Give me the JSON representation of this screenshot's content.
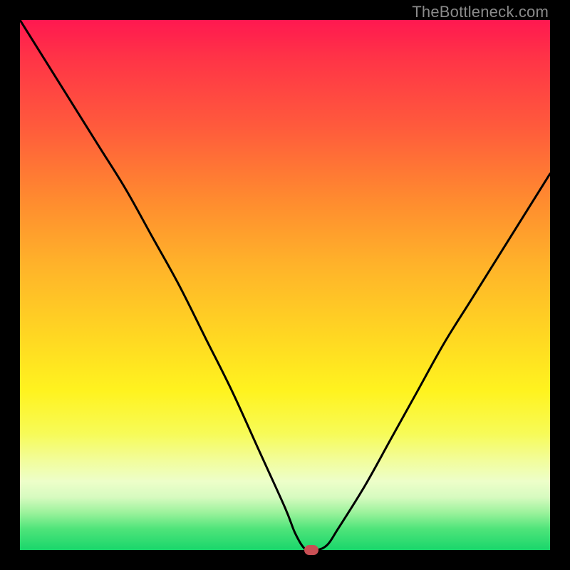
{
  "watermark": "TheBottleneck.com",
  "colors": {
    "frame": "#000000",
    "curve": "#000000",
    "marker": "#c94f54"
  },
  "chart_data": {
    "type": "line",
    "title": "",
    "xlabel": "",
    "ylabel": "",
    "xlim": [
      0,
      100
    ],
    "ylim": [
      0,
      100
    ],
    "grid": false,
    "legend": false,
    "x": [
      0,
      5,
      10,
      15,
      20,
      25,
      30,
      35,
      40,
      45,
      50,
      52,
      54,
      56,
      58,
      60,
      65,
      70,
      75,
      80,
      85,
      90,
      95,
      100
    ],
    "y": [
      100,
      92,
      84,
      76,
      68,
      59,
      50,
      40,
      30,
      19,
      8,
      3,
      0,
      0,
      1,
      4,
      12,
      21,
      30,
      39,
      47,
      55,
      63,
      71
    ],
    "marker": {
      "x": 55,
      "y": 0
    },
    "background_gradient": [
      {
        "pos": 0.0,
        "color": "#ff1850"
      },
      {
        "pos": 0.07,
        "color": "#ff3347"
      },
      {
        "pos": 0.2,
        "color": "#ff5a3c"
      },
      {
        "pos": 0.34,
        "color": "#ff8b2f"
      },
      {
        "pos": 0.46,
        "color": "#ffb22a"
      },
      {
        "pos": 0.6,
        "color": "#ffd822"
      },
      {
        "pos": 0.7,
        "color": "#fff31f"
      },
      {
        "pos": 0.78,
        "color": "#f7fb57"
      },
      {
        "pos": 0.83,
        "color": "#f2fd9a"
      },
      {
        "pos": 0.87,
        "color": "#edfec9"
      },
      {
        "pos": 0.9,
        "color": "#d7fbc0"
      },
      {
        "pos": 0.93,
        "color": "#9af29b"
      },
      {
        "pos": 0.96,
        "color": "#4fe47a"
      },
      {
        "pos": 1.0,
        "color": "#19d66b"
      }
    ]
  }
}
